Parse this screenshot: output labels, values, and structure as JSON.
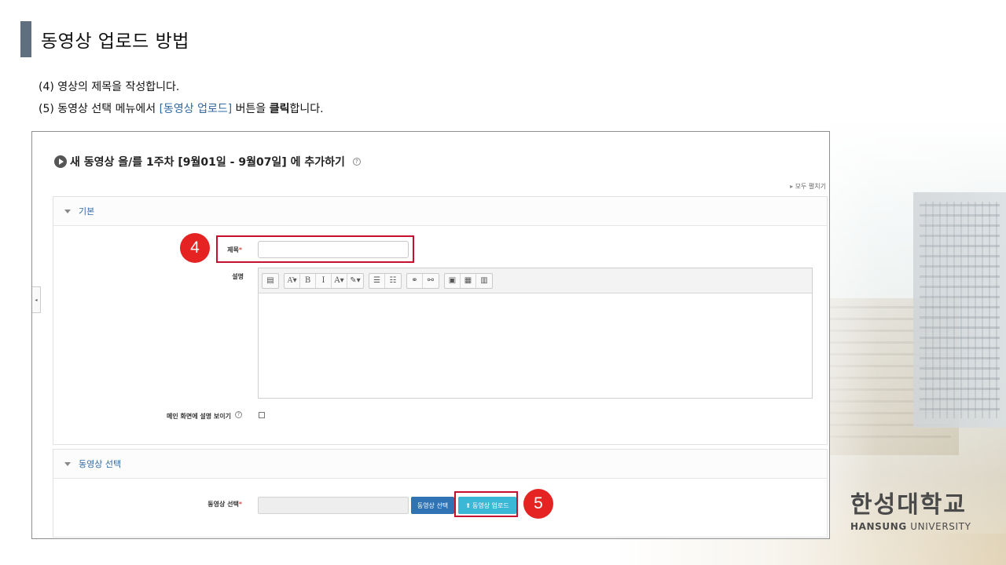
{
  "slide": {
    "title": "동영상 업로드 방법",
    "step4": "(4) 영상의 제목을 작성합니다.",
    "step5_prefix": "(5) 동영상 선택 메뉴에서 ",
    "step5_highlight": "[동영상 업로드]",
    "step5_mid": " 버튼을 ",
    "step5_bold": "클릭",
    "step5_suffix": "합니다."
  },
  "screenshot": {
    "heading": "새 동영상 을/를 1주차 [9월01일 - 9월07일] 에 추가하기",
    "help_glyph": "?",
    "expand_all": "모두 펼치기",
    "collapse_glyph": "◂",
    "basic_section": {
      "header": "기본",
      "title_label": "제목",
      "required_mark": "*",
      "title_value": "",
      "description_label": "설명",
      "show_description_label": "메인 화면에 설명 보이기",
      "show_description_checked": false
    },
    "editor_toolbar": [
      [
        "▤"
      ],
      [
        "A͂▾",
        "B",
        "I",
        "A▾",
        "✎▾"
      ],
      [
        "☰",
        "☷"
      ],
      [
        "⚭",
        "⚯"
      ],
      [
        "▣",
        "▦",
        "▥"
      ]
    ],
    "video_section": {
      "header": "동영상 선택",
      "field_label": "동영상 선택",
      "required_mark": "*",
      "file_value": "",
      "select_button": "동영상 선택",
      "upload_button": "동영상 업로드",
      "upload_glyph": "⬆"
    }
  },
  "badges": {
    "step4": "4",
    "step5": "5"
  },
  "logo": {
    "korean": "한성대학교",
    "english_bold": "HANSUNG",
    "english_rest": " UNIVERSITY"
  },
  "colors": {
    "accent_bar": "#5f6f80",
    "highlight_text": "#2f6aa3",
    "annotation_red": "#e52322",
    "select_button": "#2f73b5",
    "upload_button": "#3bb8d6"
  }
}
